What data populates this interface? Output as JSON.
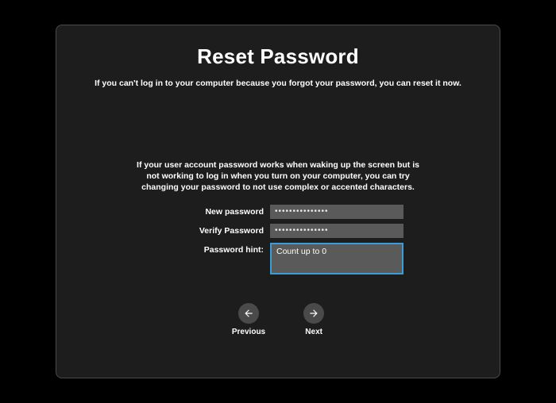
{
  "title": "Reset Password",
  "subtitle": "If you can't log in to your computer because you forgot your password, you can reset it now.",
  "help_text": "If your user account password works when waking up the screen but is not working to log in when you turn on your computer, you can try changing your password to not use complex or accented characters.",
  "form": {
    "new_password_label": "New password",
    "new_password_value": "•••••••••••••••",
    "verify_password_label": "Verify Password",
    "verify_password_value": "•••••••••••••••",
    "password_hint_label": "Password  hint:",
    "password_hint_value": "Count up to 0"
  },
  "nav": {
    "previous_label": "Previous",
    "next_label": "Next"
  }
}
